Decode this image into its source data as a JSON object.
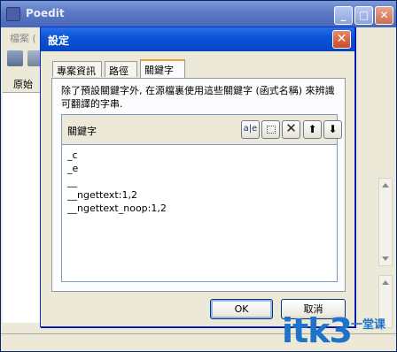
{
  "background_window": {
    "title": "Poedit",
    "menu_partial": "檔案 (",
    "list_header_partial": "原始字",
    "controls": {
      "minimize": "_",
      "maximize": "□",
      "close": "✕"
    }
  },
  "dialog": {
    "title": "設定",
    "close_glyph": "✕",
    "tabs": [
      {
        "label": "專案資訊",
        "active": false
      },
      {
        "label": "路徑",
        "active": false
      },
      {
        "label": "關鍵字",
        "active": true
      }
    ],
    "description": "除了預設關鍵字外, 在源檔裏使用這些關鍵字 (函式名稱) 來辨識可翻譯的字串.",
    "keywords_panel": {
      "label": "關鍵字",
      "buttons": {
        "edit_icon": "a|e",
        "delete_icon": "✕",
        "up_icon": "⬆",
        "down_icon": "⬇"
      },
      "items": [
        "_c",
        "_e",
        "__",
        "__ngettext:1,2",
        "__ngettext_noop:1,2"
      ]
    },
    "ok_label": "OK",
    "cancel_label": "取消"
  },
  "watermark": {
    "text": "itk3",
    "sub": "一堂课"
  },
  "colors": {
    "dialog_titlebar": "#0a56d8",
    "window_face": "#ece9d8",
    "active_tab_accent": "#e7a13b",
    "watermark": "#1e73c8"
  }
}
